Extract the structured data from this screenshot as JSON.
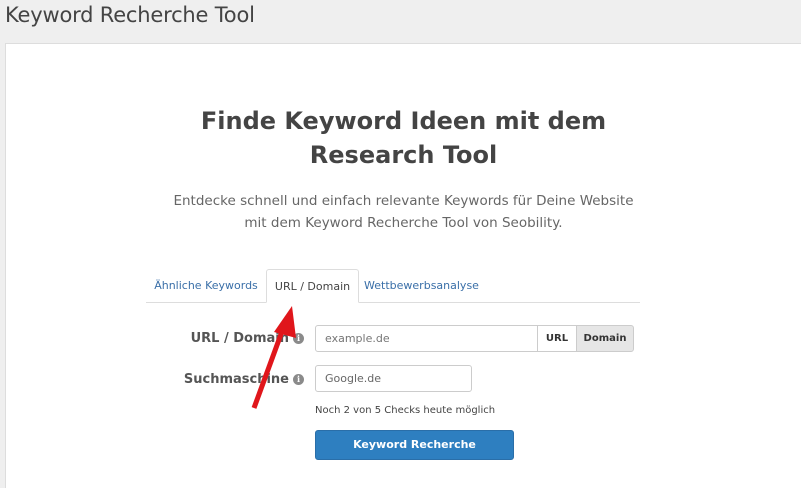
{
  "page": {
    "title": "Keyword Recherche Tool"
  },
  "hero": {
    "headline_line1": "Finde Keyword Ideen mit dem",
    "headline_line2": "Research Tool",
    "sub_line1": "Entdecke schnell und einfach relevante Keywords für Deine Website",
    "sub_line2": "mit dem Keyword Recherche Tool von Seobility."
  },
  "tabs": [
    {
      "label": "Ähnliche Keywords",
      "active": false
    },
    {
      "label": "URL / Domain",
      "active": true
    },
    {
      "label": "Wettbewerbsanalyse",
      "active": false
    }
  ],
  "form": {
    "url_label": "URL / Domain",
    "url_placeholder": "example.de",
    "url_mode_url": "URL",
    "url_mode_domain": "Domain",
    "engine_label": "Suchmaschine",
    "engine_value": "Google.de",
    "info_glyph": "i",
    "checks_note": "Noch 2 von 5 Checks heute möglich",
    "submit_label": "Keyword Recherche"
  },
  "colors": {
    "accent": "#2e7fc0",
    "tab_link": "#3a6fa8",
    "annotation_arrow": "#e0161b"
  },
  "icons": {
    "info": "info-icon",
    "annotation": "red-arrow-annotation"
  }
}
